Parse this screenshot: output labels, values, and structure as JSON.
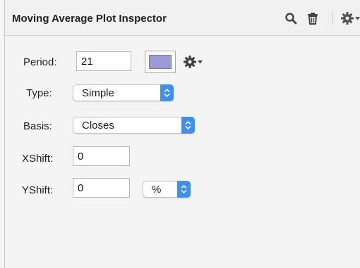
{
  "inspector": {
    "title": "Moving Average Plot Inspector",
    "toolbar_icons": [
      "search-icon",
      "trash-icon",
      "gear-icon",
      "chevron-down-icon"
    ]
  },
  "fields": {
    "period": {
      "label": "Period:",
      "value": "21"
    },
    "type": {
      "label": "Type:",
      "selected": "Simple"
    },
    "basis": {
      "label": "Basis:",
      "selected": "Closes"
    },
    "xshift": {
      "label": "XShift:",
      "value": "0"
    },
    "yshift": {
      "label": "YShift:",
      "value": "0",
      "unit_selected": "%"
    }
  },
  "colors": {
    "plot_color": "#9b9bd8",
    "accent": "#3b8ff6"
  }
}
